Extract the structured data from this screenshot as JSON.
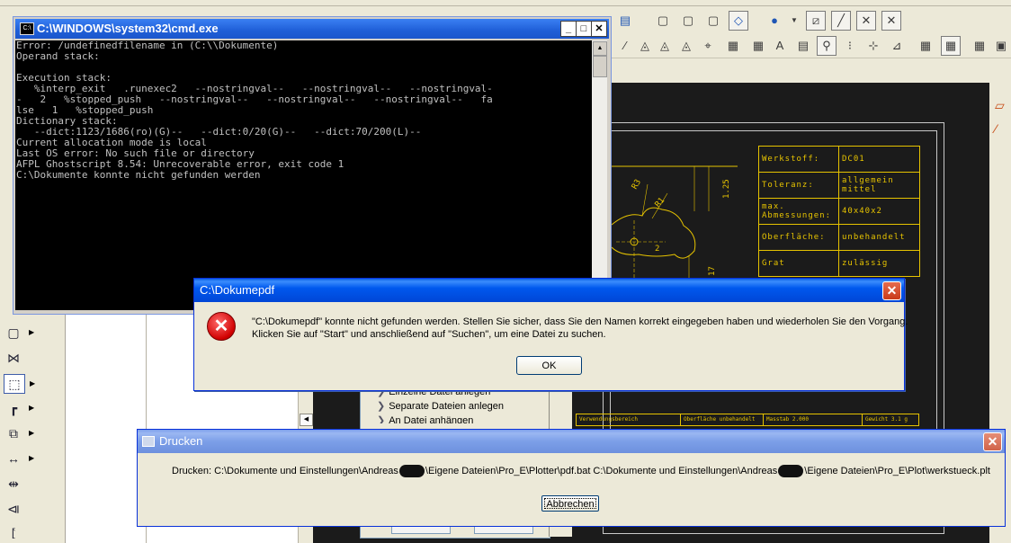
{
  "cmd_window": {
    "title": "C:\\WINDOWS\\system32\\cmd.exe",
    "icon": "cmd-icon",
    "lines": [
      "Error: /undefinedfilename in (C:\\\\Dokumente)",
      "Operand stack:",
      "",
      "Execution stack:",
      "   %interp_exit   .runexec2   --nostringval--   --nostringval--   --nostringval-",
      "-   2   %stopped_push   --nostringval--   --nostringval--   --nostringval--   fa",
      "lse   1   %stopped_push",
      "Dictionary stack:",
      "   --dict:1123/1686(ro)(G)--   --dict:0/20(G)--   --dict:70/200(L)--",
      "Current allocation mode is local",
      "Last OS error: No such file or directory",
      "AFPL Ghostscript 8.54: Unrecoverable error, exit code 1",
      "C:\\Dokumente konnte nicht gefunden werden"
    ]
  },
  "error_dialog": {
    "title": "C:\\Dokumepdf",
    "message_line1": "\"C:\\Dokumepdf\" konnte nicht gefunden werden. Stellen Sie sicher, dass Sie den Namen korrekt eingegeben haben und wiederholen Sie den Vorgang.",
    "message_line2": "Klicken Sie auf \"Start\" und anschließend auf \"Suchen\", um eine Datei zu suchen.",
    "ok_label": "OK"
  },
  "print_dialog": {
    "title": "Drucken",
    "path_part1": "Drucken:  C:\\Dokumente und Einstellungen\\Andreas",
    "path_part2": "\\Eigene Dateien\\Pro_E\\Plotter\\pdf.bat C:\\Dokumente und Einstellungen\\Andreas",
    "path_part3": "\\Eigene Dateien\\Pro_E\\Plot\\werkstueck.plt",
    "cancel_label": "Abbrechen"
  },
  "title_block": {
    "rows": [
      {
        "key": "Werkstoff:",
        "value": "DC01"
      },
      {
        "key": "Toleranz:",
        "value": "allgemein mittel"
      },
      {
        "key": "max. Abmessungen:",
        "value": "40x40x2"
      },
      {
        "key": "Oberfläche:",
        "value": "unbehandelt"
      },
      {
        "key": "Grat",
        "value": "zulässig"
      }
    ],
    "bottom_cells": [
      "Verwendungsbereich",
      "Oberfläche unbehandelt",
      "Masstab 2.000",
      "Gewicht 3.1 g"
    ]
  },
  "drawing": {
    "dims": [
      "R3",
      "R1",
      "1.25",
      "2",
      "17"
    ]
  },
  "sub_panel": {
    "items": [
      "Einzelne Datei anlegen",
      "Separate Dateien anlegen",
      "An Datei anhängen"
    ]
  },
  "colors": {
    "canvas": "#1b1b1b",
    "drawing_yellow": "#e6c300",
    "xp_blue": "#0058ee"
  }
}
